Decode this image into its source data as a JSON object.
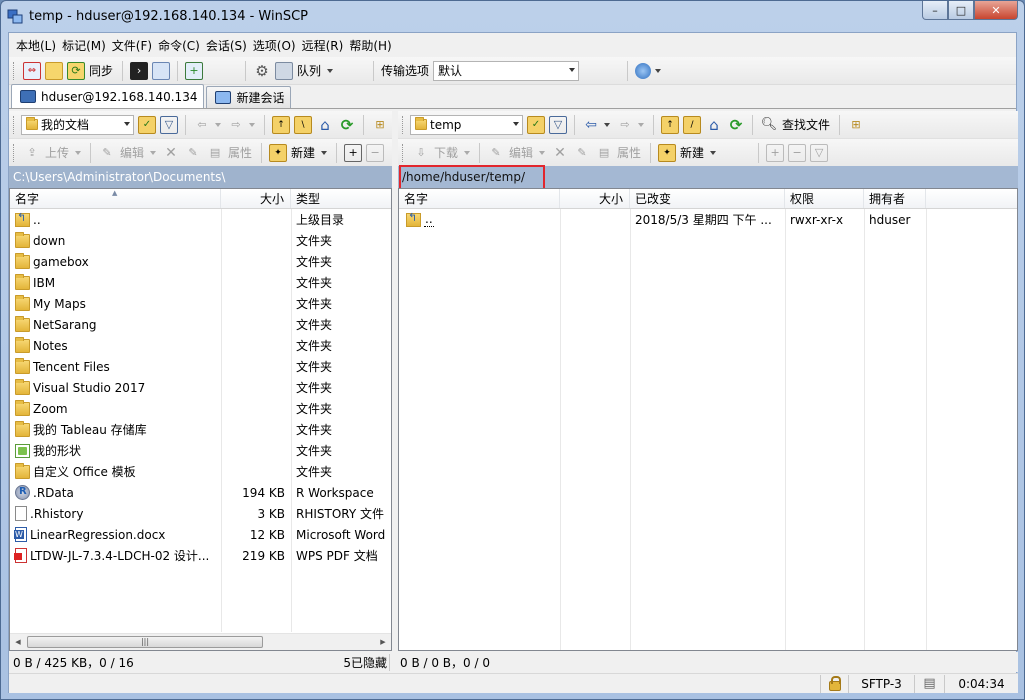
{
  "window": {
    "title": "temp - hduser@192.168.140.134 - WinSCP",
    "min": "–",
    "max": "□",
    "close": "✕"
  },
  "menu": [
    "本地(L)",
    "标记(M)",
    "文件(F)",
    "命令(C)",
    "会话(S)",
    "选项(O)",
    "远程(R)",
    "帮助(H)"
  ],
  "toolbar": {
    "sync_label": "同步",
    "queue_label": "队列",
    "transfer_label": "传输选项",
    "transfer_value": "默认"
  },
  "tabs": [
    {
      "label": "hduser@192.168.140.134"
    },
    {
      "label": "新建会话"
    }
  ],
  "left": {
    "location": "我的文档",
    "upload_label": "上传",
    "edit_label": "编辑",
    "props_label": "属性",
    "new_label": "新建",
    "path": "C:\\Users\\Administrator\\Documents\\",
    "columns": {
      "name": "名字",
      "size": "大小",
      "type": "类型"
    },
    "files": [
      {
        "name": "..",
        "size": "",
        "type": "上级目录",
        "icon": "updir"
      },
      {
        "name": "down",
        "size": "",
        "type": "文件夹",
        "icon": "folder"
      },
      {
        "name": "gamebox",
        "size": "",
        "type": "文件夹",
        "icon": "folder"
      },
      {
        "name": "IBM",
        "size": "",
        "type": "文件夹",
        "icon": "folder"
      },
      {
        "name": "My Maps",
        "size": "",
        "type": "文件夹",
        "icon": "folder"
      },
      {
        "name": "NetSarang",
        "size": "",
        "type": "文件夹",
        "icon": "folder"
      },
      {
        "name": "Notes",
        "size": "",
        "type": "文件夹",
        "icon": "folder"
      },
      {
        "name": "Tencent Files",
        "size": "",
        "type": "文件夹",
        "icon": "folder"
      },
      {
        "name": "Visual Studio 2017",
        "size": "",
        "type": "文件夹",
        "icon": "folder"
      },
      {
        "name": "Zoom",
        "size": "",
        "type": "文件夹",
        "icon": "folder"
      },
      {
        "name": "我的 Tableau 存储库",
        "size": "",
        "type": "文件夹",
        "icon": "folder"
      },
      {
        "name": "我的形状",
        "size": "",
        "type": "文件夹",
        "icon": "shapefile"
      },
      {
        "name": "自定义 Office 模板",
        "size": "",
        "type": "文件夹",
        "icon": "folder"
      },
      {
        "name": ".RData",
        "size": "194 KB",
        "type": "R Workspace",
        "icon": "rfile"
      },
      {
        "name": ".Rhistory",
        "size": "3 KB",
        "type": "RHISTORY 文件",
        "icon": "docfile"
      },
      {
        "name": "LinearRegression.docx",
        "size": "12 KB",
        "type": "Microsoft Word",
        "icon": "wordfile"
      },
      {
        "name": "LTDW-JL-7.3.4-LDCH-02 设计...",
        "size": "219 KB",
        "type": "WPS PDF 文档",
        "icon": "pdffile"
      }
    ],
    "status": "0 B / 425 KB，0 / 16",
    "hidden": "5已隐藏"
  },
  "right": {
    "location": "temp",
    "download_label": "下载",
    "edit_label": "编辑",
    "props_label": "属性",
    "new_label": "新建",
    "find_label": "查找文件",
    "path": "/home/hduser/temp/",
    "columns": {
      "name": "名字",
      "size": "大小",
      "changed": "已改变",
      "rights": "权限",
      "owner": "拥有者"
    },
    "files": [
      {
        "name": "..",
        "size": "",
        "changed": "2018/5/3 星期四 下午 ...",
        "rights": "rwxr-xr-x",
        "owner": "hduser",
        "icon": "updir"
      }
    ],
    "status": "0 B / 0 B，0 / 0"
  },
  "statusbar": {
    "protocol": "SFTP-3",
    "time": "0:04:34"
  }
}
